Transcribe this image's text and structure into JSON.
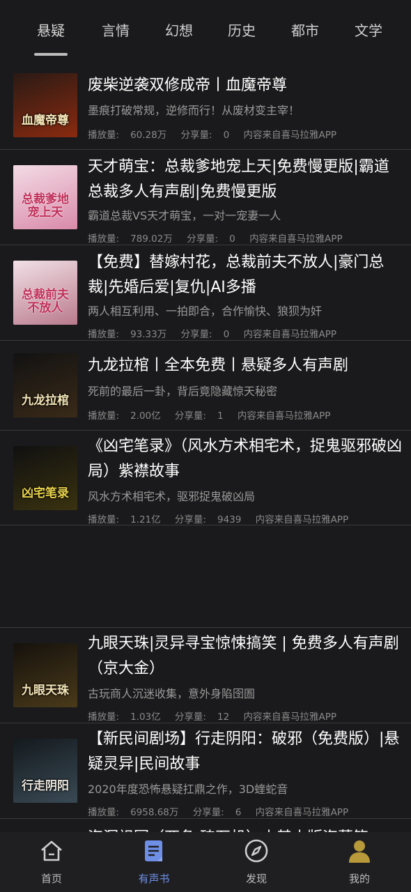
{
  "tabs": [
    "悬疑",
    "言情",
    "幻想",
    "历史",
    "都市",
    "文学"
  ],
  "active_tab": "悬疑",
  "stats_labels": {
    "plays": "播放量:",
    "shares": "分享量:"
  },
  "items": [
    {
      "title": "废柴逆袭双修成帝丨血魔帝尊",
      "desc": "墨痕打破常规，逆修而行！从废材变主宰！",
      "plays": "60.28万",
      "shares": "0",
      "source": "内容来自喜马拉雅APP",
      "cover_text": "血魔帝尊",
      "cover_colors": [
        "#2a1a14",
        "#8a2a10"
      ]
    },
    {
      "title": "天才萌宝：总裁爹地宠上天|免费慢更版|霸道总裁多人有声剧|免费慢更版",
      "desc": "霸道总裁VS天才萌宝，一对一宠妻一人",
      "plays": "789.02万",
      "shares": "0",
      "source": "内容来自喜马拉雅APP",
      "cover_text": "总裁爹地宠上天",
      "cover_colors": [
        "#f3dbe6",
        "#d98aa8"
      ]
    },
    {
      "title": "【免费】替嫁村花，总裁前夫不放人|豪门总裁|先婚后爱|复仇|AI多播",
      "desc": "两人相互利用、一拍即合，合作愉快、狼狈为奸",
      "plays": "93.33万",
      "shares": "0",
      "source": "内容来自喜马拉雅APP",
      "cover_text": "总裁前夫不放人",
      "cover_colors": [
        "#f1e0e6",
        "#b97a8c"
      ]
    },
    {
      "title": "九龙拉棺丨全本免费丨悬疑多人有声剧",
      "desc": "死前的最后一卦，背后竟隐藏惊天秘密",
      "plays": "2.00亿",
      "shares": "1",
      "source": "内容来自喜马拉雅APP",
      "cover_text": "九龙拉棺",
      "cover_colors": [
        "#121212",
        "#3a2a18"
      ]
    },
    {
      "title": "《凶宅笔录》（风水方术相宅术，捉鬼驱邪破凶局）紫襟故事",
      "desc": "风水方术相宅术，驱邪捉鬼破凶局",
      "plays": "1.21亿",
      "shares": "9439",
      "source": "内容来自喜马拉雅APP",
      "cover_text": "凶宅笔录",
      "cover_colors": [
        "#101010",
        "#3a3210"
      ]
    },
    {
      "title": "九眼天珠|灵异寻宝惊悚搞笑 | 免费多人有声剧（京大金）",
      "desc": "古玩商人沉迷收集，意外身陷囹圄",
      "plays": "1.03亿",
      "shares": "12",
      "source": "内容来自喜马拉雅APP",
      "cover_text": "九眼天珠",
      "cover_colors": [
        "#15110c",
        "#4a3a1a"
      ]
    },
    {
      "title": "【新民间剧场】行走阴阳：破邪（免费版）|悬疑灵异|民间故事",
      "desc": "2020年度恐怖悬疑扛鼎之作，3D蝰蛇音",
      "plays": "6958.68万",
      "shares": "6",
      "source": "内容来自喜马拉雅APP",
      "cover_text": "行走阴阳",
      "cover_colors": [
        "#141a1e",
        "#3a4a55"
      ]
    }
  ],
  "partial_title": "盗洞祖园（两条·砖石机）丨基小版盗墓笔",
  "bottom_nav": [
    {
      "label": "首页",
      "icon": "home-icon"
    },
    {
      "label": "有声书",
      "icon": "audiobook-icon"
    },
    {
      "label": "发现",
      "icon": "compass-icon"
    },
    {
      "label": "我的",
      "icon": "profile-icon"
    }
  ],
  "active_nav": "有声书",
  "colors": {
    "background": "#1a1a1c",
    "nav_active": "#6f8fe6",
    "divider": "#3a3a3c"
  }
}
